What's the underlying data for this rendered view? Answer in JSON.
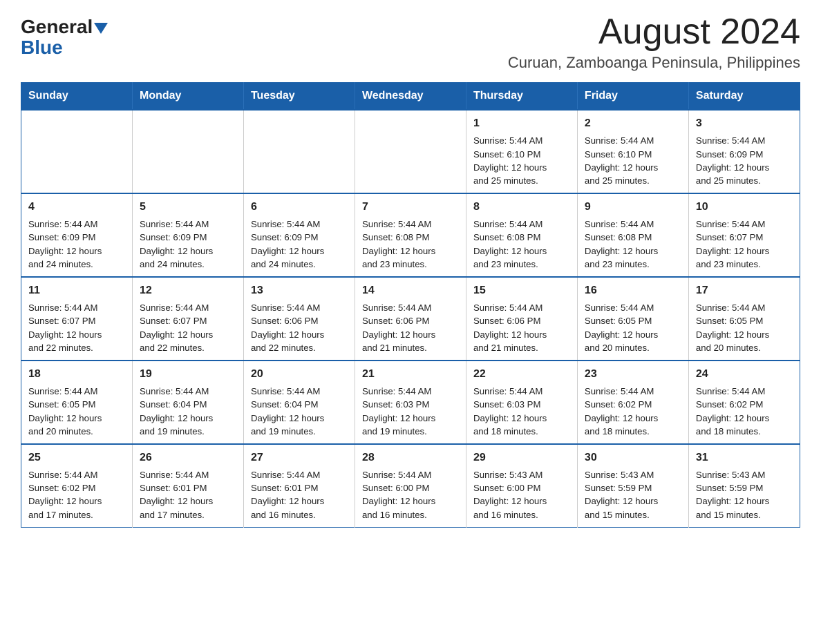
{
  "logo": {
    "general": "General",
    "blue": "Blue"
  },
  "header": {
    "month": "August 2024",
    "location": "Curuan, Zamboanga Peninsula, Philippines"
  },
  "days_of_week": [
    "Sunday",
    "Monday",
    "Tuesday",
    "Wednesday",
    "Thursday",
    "Friday",
    "Saturday"
  ],
  "weeks": [
    [
      {
        "day": "",
        "info": ""
      },
      {
        "day": "",
        "info": ""
      },
      {
        "day": "",
        "info": ""
      },
      {
        "day": "",
        "info": ""
      },
      {
        "day": "1",
        "info": "Sunrise: 5:44 AM\nSunset: 6:10 PM\nDaylight: 12 hours\nand 25 minutes."
      },
      {
        "day": "2",
        "info": "Sunrise: 5:44 AM\nSunset: 6:10 PM\nDaylight: 12 hours\nand 25 minutes."
      },
      {
        "day": "3",
        "info": "Sunrise: 5:44 AM\nSunset: 6:09 PM\nDaylight: 12 hours\nand 25 minutes."
      }
    ],
    [
      {
        "day": "4",
        "info": "Sunrise: 5:44 AM\nSunset: 6:09 PM\nDaylight: 12 hours\nand 24 minutes."
      },
      {
        "day": "5",
        "info": "Sunrise: 5:44 AM\nSunset: 6:09 PM\nDaylight: 12 hours\nand 24 minutes."
      },
      {
        "day": "6",
        "info": "Sunrise: 5:44 AM\nSunset: 6:09 PM\nDaylight: 12 hours\nand 24 minutes."
      },
      {
        "day": "7",
        "info": "Sunrise: 5:44 AM\nSunset: 6:08 PM\nDaylight: 12 hours\nand 23 minutes."
      },
      {
        "day": "8",
        "info": "Sunrise: 5:44 AM\nSunset: 6:08 PM\nDaylight: 12 hours\nand 23 minutes."
      },
      {
        "day": "9",
        "info": "Sunrise: 5:44 AM\nSunset: 6:08 PM\nDaylight: 12 hours\nand 23 minutes."
      },
      {
        "day": "10",
        "info": "Sunrise: 5:44 AM\nSunset: 6:07 PM\nDaylight: 12 hours\nand 23 minutes."
      }
    ],
    [
      {
        "day": "11",
        "info": "Sunrise: 5:44 AM\nSunset: 6:07 PM\nDaylight: 12 hours\nand 22 minutes."
      },
      {
        "day": "12",
        "info": "Sunrise: 5:44 AM\nSunset: 6:07 PM\nDaylight: 12 hours\nand 22 minutes."
      },
      {
        "day": "13",
        "info": "Sunrise: 5:44 AM\nSunset: 6:06 PM\nDaylight: 12 hours\nand 22 minutes."
      },
      {
        "day": "14",
        "info": "Sunrise: 5:44 AM\nSunset: 6:06 PM\nDaylight: 12 hours\nand 21 minutes."
      },
      {
        "day": "15",
        "info": "Sunrise: 5:44 AM\nSunset: 6:06 PM\nDaylight: 12 hours\nand 21 minutes."
      },
      {
        "day": "16",
        "info": "Sunrise: 5:44 AM\nSunset: 6:05 PM\nDaylight: 12 hours\nand 20 minutes."
      },
      {
        "day": "17",
        "info": "Sunrise: 5:44 AM\nSunset: 6:05 PM\nDaylight: 12 hours\nand 20 minutes."
      }
    ],
    [
      {
        "day": "18",
        "info": "Sunrise: 5:44 AM\nSunset: 6:05 PM\nDaylight: 12 hours\nand 20 minutes."
      },
      {
        "day": "19",
        "info": "Sunrise: 5:44 AM\nSunset: 6:04 PM\nDaylight: 12 hours\nand 19 minutes."
      },
      {
        "day": "20",
        "info": "Sunrise: 5:44 AM\nSunset: 6:04 PM\nDaylight: 12 hours\nand 19 minutes."
      },
      {
        "day": "21",
        "info": "Sunrise: 5:44 AM\nSunset: 6:03 PM\nDaylight: 12 hours\nand 19 minutes."
      },
      {
        "day": "22",
        "info": "Sunrise: 5:44 AM\nSunset: 6:03 PM\nDaylight: 12 hours\nand 18 minutes."
      },
      {
        "day": "23",
        "info": "Sunrise: 5:44 AM\nSunset: 6:02 PM\nDaylight: 12 hours\nand 18 minutes."
      },
      {
        "day": "24",
        "info": "Sunrise: 5:44 AM\nSunset: 6:02 PM\nDaylight: 12 hours\nand 18 minutes."
      }
    ],
    [
      {
        "day": "25",
        "info": "Sunrise: 5:44 AM\nSunset: 6:02 PM\nDaylight: 12 hours\nand 17 minutes."
      },
      {
        "day": "26",
        "info": "Sunrise: 5:44 AM\nSunset: 6:01 PM\nDaylight: 12 hours\nand 17 minutes."
      },
      {
        "day": "27",
        "info": "Sunrise: 5:44 AM\nSunset: 6:01 PM\nDaylight: 12 hours\nand 16 minutes."
      },
      {
        "day": "28",
        "info": "Sunrise: 5:44 AM\nSunset: 6:00 PM\nDaylight: 12 hours\nand 16 minutes."
      },
      {
        "day": "29",
        "info": "Sunrise: 5:43 AM\nSunset: 6:00 PM\nDaylight: 12 hours\nand 16 minutes."
      },
      {
        "day": "30",
        "info": "Sunrise: 5:43 AM\nSunset: 5:59 PM\nDaylight: 12 hours\nand 15 minutes."
      },
      {
        "day": "31",
        "info": "Sunrise: 5:43 AM\nSunset: 5:59 PM\nDaylight: 12 hours\nand 15 minutes."
      }
    ]
  ]
}
